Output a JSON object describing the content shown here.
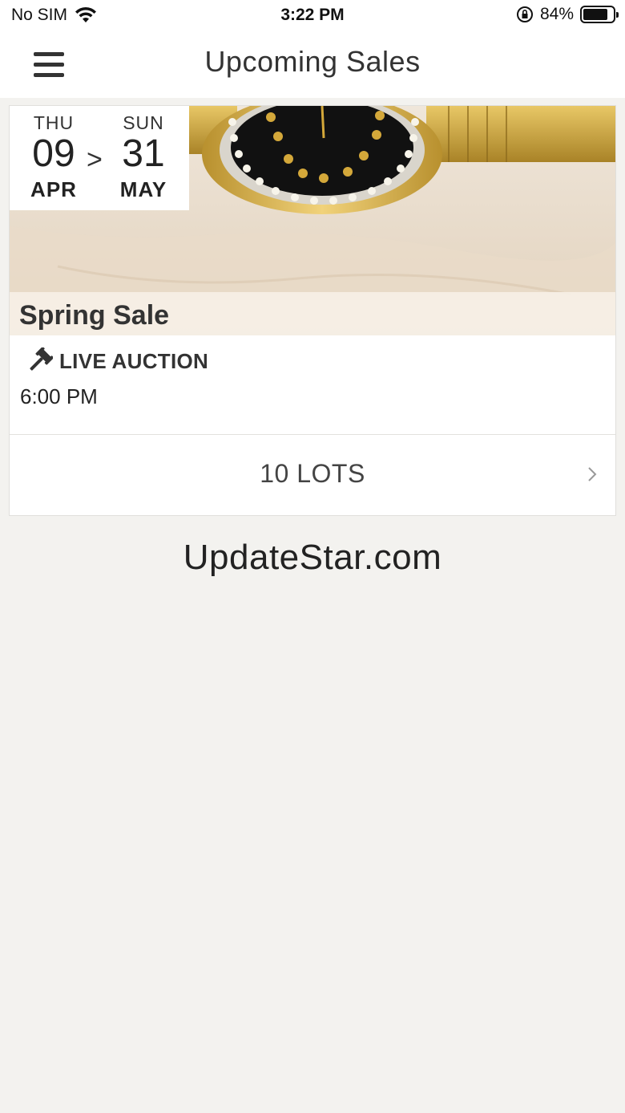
{
  "status_bar": {
    "carrier": "No SIM",
    "time": "3:22 PM",
    "battery_percent": "84%",
    "battery_level": 0.84
  },
  "nav": {
    "title": "Upcoming Sales",
    "menu_icon": "hamburger-menu-icon"
  },
  "sale": {
    "start": {
      "dow": "THU",
      "day": "09",
      "month": "APR"
    },
    "separator": ">",
    "end": {
      "dow": "SUN",
      "day": "31",
      "month": "MAY"
    },
    "image_desc": "gold-watch-photo",
    "title": "Spring Sale",
    "auction_type": "LIVE AUCTION",
    "auction_icon": "gavel-icon",
    "time": "6:00 PM",
    "lots_label": "10 LOTS"
  },
  "watermark": "UpdateStar.com"
}
